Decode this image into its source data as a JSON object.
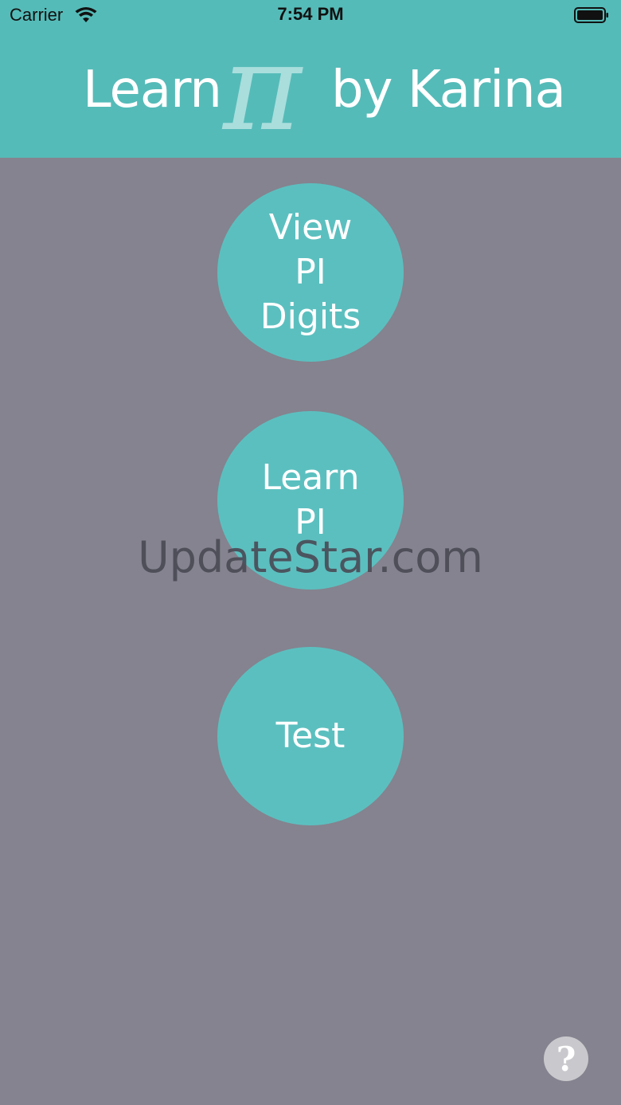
{
  "status_bar": {
    "carrier": "Carrier",
    "time": "7:54 PM",
    "wifi_icon": "wifi-icon",
    "battery_icon": "battery-icon"
  },
  "header": {
    "title_left": "Learn",
    "title_pi": "π",
    "title_right": "by Karina"
  },
  "buttons": {
    "view_digits": "View\nPI\nDigits",
    "learn_pi": "Learn\nPI",
    "test": "Test"
  },
  "watermark": "UpdateStar.com",
  "help": {
    "label": "?",
    "icon": "question-mark-icon"
  },
  "colors": {
    "header_bg": "#55bbb8",
    "page_bg": "#84838f",
    "button_bg": "#5cbfbf",
    "pi_color": "#a9dedd",
    "help_bg": "#c9c9cd"
  }
}
